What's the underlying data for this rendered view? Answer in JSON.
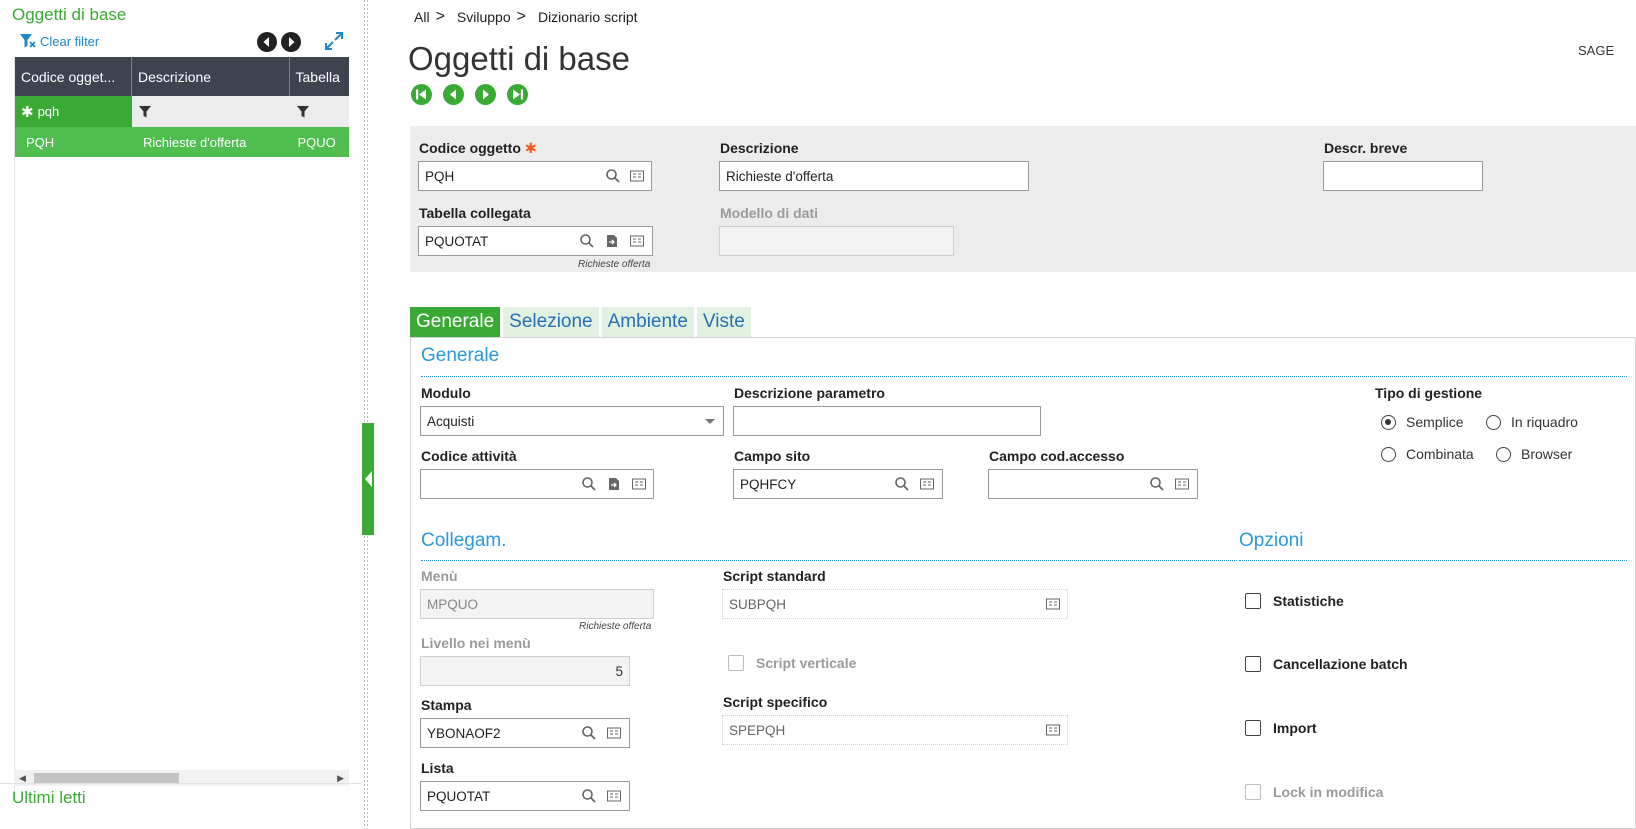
{
  "left_panel": {
    "title": "Oggetti di base",
    "clear_filter": "Clear filter",
    "columns": [
      "Codice ogget...",
      "Descrizione",
      "Tabella"
    ],
    "filter_value": "pqh",
    "rows": [
      {
        "code": "PQH",
        "description": "Richieste d'offerta",
        "table": "PQUO"
      }
    ],
    "recent_title": "Ultimi letti"
  },
  "breadcrumb": {
    "items": [
      "All",
      "Sviluppo",
      "Dizionario script"
    ]
  },
  "page": {
    "title": "Oggetti di base",
    "user": "SAGE"
  },
  "header": {
    "codice_oggetto_label": "Codice oggetto",
    "codice_oggetto_value": "PQH",
    "descrizione_label": "Descrizione",
    "descrizione_value": "Richieste d'offerta",
    "descr_breve_label": "Descr. breve",
    "descr_breve_value": "",
    "tabella_label": "Tabella collegata",
    "tabella_value": "PQUOTAT",
    "tabella_hint": "Richieste offerta",
    "modello_label": "Modello di dati",
    "modello_value": ""
  },
  "tabs": [
    {
      "label": "Generale",
      "active": true
    },
    {
      "label": "Selezione",
      "active": false
    },
    {
      "label": "Ambiente",
      "active": false
    },
    {
      "label": "Viste",
      "active": false
    }
  ],
  "generale": {
    "section_title": "Generale",
    "modulo_label": "Modulo",
    "modulo_value": "Acquisti",
    "descr_param_label": "Descrizione parametro",
    "descr_param_value": "",
    "tipo_label": "Tipo di gestione",
    "tipo_options": [
      {
        "label": "Semplice",
        "selected": true
      },
      {
        "label": "In riquadro",
        "selected": false
      },
      {
        "label": "Combinata",
        "selected": false
      },
      {
        "label": "Browser",
        "selected": false
      }
    ],
    "codice_att_label": "Codice attività",
    "codice_att_value": "",
    "campo_sito_label": "Campo sito",
    "campo_sito_value": "PQHFCY",
    "campo_cod_label": "Campo cod.accesso",
    "campo_cod_value": ""
  },
  "collegam": {
    "section_title": "Collegam.",
    "menu_label": "Menù",
    "menu_value": "MPQUO",
    "menu_hint": "Richieste offerta",
    "livello_label": "Livello nei menù",
    "livello_value": "5",
    "stampa_label": "Stampa",
    "stampa_value": "YBONAOF2",
    "lista_label": "Lista",
    "lista_value": "PQUOTAT",
    "script_std_label": "Script standard",
    "script_std_value": "SUBPQH",
    "script_vert_label": "Script verticale",
    "script_spec_label": "Script specifico",
    "script_spec_value": "SPEPQH"
  },
  "opzioni": {
    "section_title": "Opzioni",
    "items": [
      {
        "label": "Statistiche",
        "checked": false,
        "disabled": false
      },
      {
        "label": "Cancellazione batch",
        "checked": false,
        "disabled": false
      },
      {
        "label": "Import",
        "checked": false,
        "disabled": false
      },
      {
        "label": "Lock in modifica",
        "checked": false,
        "disabled": true
      }
    ]
  },
  "colors": {
    "accent_green": "#3aaa35",
    "section_blue": "#2a9ad8",
    "grid_header": "#3d4450",
    "row_selected": "#4fbe4f"
  }
}
